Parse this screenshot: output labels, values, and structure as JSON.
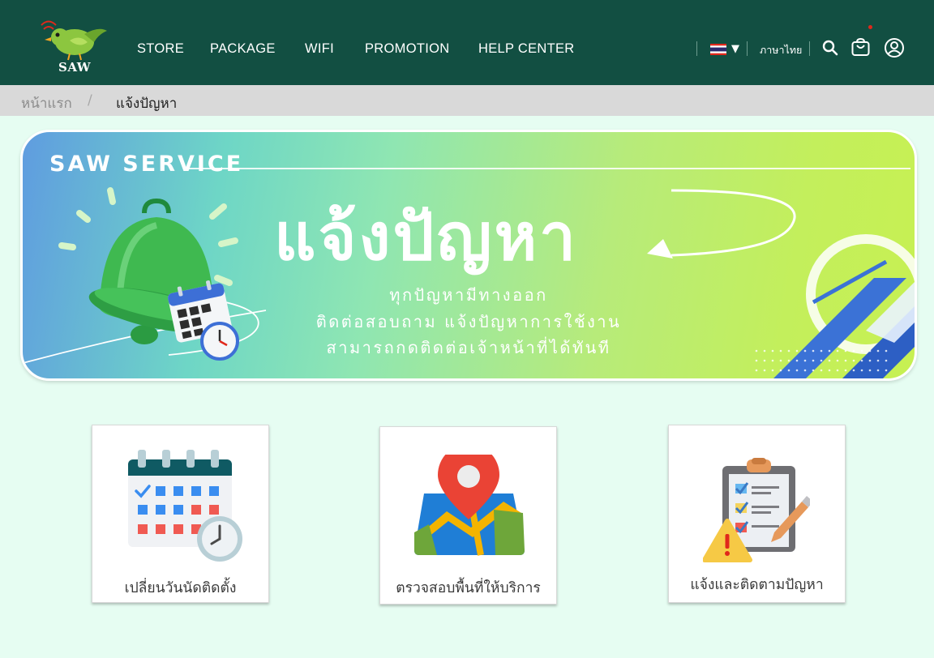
{
  "brand": {
    "logo_text": "SAW"
  },
  "nav": {
    "items": [
      {
        "label": "STORE"
      },
      {
        "label": "PACKAGE"
      },
      {
        "label": "WIFI"
      },
      {
        "label": "PROMOTION"
      },
      {
        "label": "HELP CENTER"
      }
    ]
  },
  "header": {
    "language": "ภาษาไทย",
    "icons": [
      "thai-flag-icon",
      "chevron-down-icon",
      "search-icon",
      "cart-icon",
      "user-icon"
    ]
  },
  "breadcrumb": {
    "home": "หน้าแรก",
    "separator": "/",
    "current": "แจ้งปัญหา"
  },
  "banner": {
    "service": "SAW SERVICE",
    "title": "แจ้งปัญหา",
    "lines": [
      "ทุกปัญหามีทางออก",
      "ติดต่อสอบถาม แจ้งปัญหาการใช้งาน",
      "สามารถกดติดต่อเจ้าหน้าที่ได้ทันที"
    ]
  },
  "cards": [
    {
      "label": "เปลี่ยนวันนัดติดตั้ง",
      "icon": "calendar-clock-icon"
    },
    {
      "label": "ตรวจสอบพื้นที่ให้บริการ",
      "icon": "map-pin-icon"
    },
    {
      "label": "แจ้งและติดตามปัญหา",
      "icon": "clipboard-warning-icon"
    }
  ],
  "colors": {
    "header_bg": "#124f42",
    "page_bg": "#e6fdf2",
    "crumb_bg": "#d9d9d9",
    "accent_red": "#e0281b"
  }
}
